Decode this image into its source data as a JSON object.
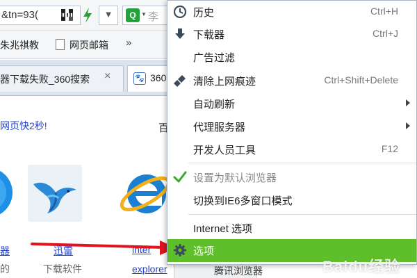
{
  "address_bar": {
    "url_fragment": "&tn=93(",
    "search_placeholder": "李"
  },
  "favorites": {
    "items": [
      "朱兆祺教",
      "网页邮箱"
    ],
    "more": "»"
  },
  "tabs": [
    {
      "title": "器下载失败_360搜索",
      "close": "×"
    },
    {
      "title": "360"
    }
  ],
  "page": {
    "promo": "网页快2秒!",
    "promo_right": "百",
    "apps": [
      {
        "name": "器",
        "sub": "的"
      },
      {
        "name": "迅雷",
        "sub": "下载软件"
      },
      {
        "name": "inter",
        "sub": "explorer"
      }
    ],
    "tencent_button": "腾讯浏览器"
  },
  "menu": {
    "items": [
      {
        "label": "历史",
        "shortcut": "Ctrl+H",
        "icon": "clock-icon"
      },
      {
        "label": "下载器",
        "shortcut": "Ctrl+J",
        "icon": "download-arrow-icon"
      },
      {
        "label": "广告过滤",
        "shortcut": "",
        "icon": ""
      },
      {
        "label": "清除上网痕迹",
        "shortcut": "Ctrl+Shift+Delete",
        "icon": "broom-icon"
      },
      {
        "label": "自动刷新",
        "shortcut": "",
        "icon": "",
        "submenu": true
      },
      {
        "label": "代理服务器",
        "shortcut": "",
        "icon": "",
        "submenu": true
      },
      {
        "label": "开发人员工具",
        "shortcut": "F12",
        "icon": ""
      },
      {
        "label": "设置为默认浏览器",
        "shortcut": "",
        "icon": "checkmark-icon",
        "disabled": true
      },
      {
        "label": "切换到IE6多窗口模式",
        "shortcut": "",
        "icon": ""
      },
      {
        "label": "Internet 选项",
        "shortcut": "",
        "icon": ""
      },
      {
        "label": "选项",
        "shortcut": "",
        "icon": "gear-icon",
        "highlighted": true
      }
    ]
  },
  "watermark": "Baidu经验",
  "colors": {
    "highlight": "#5fbf2a",
    "link": "#2244cc",
    "check": "#3aa82a",
    "arrow": "#e0141e"
  }
}
